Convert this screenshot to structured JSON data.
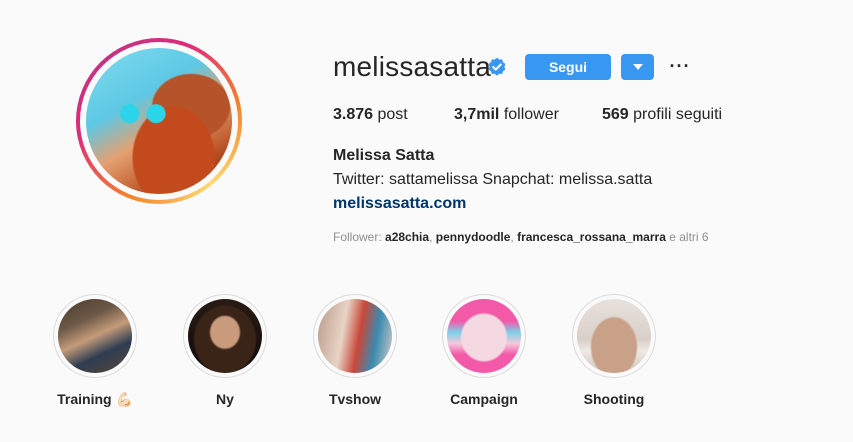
{
  "profile": {
    "username": "melissasatta",
    "follow_label": "Segui",
    "more_label": "···",
    "stats": {
      "posts_value": "3.876",
      "posts_label": "post",
      "followers_value": "3,7mil",
      "followers_label": "follower",
      "following_value": "569",
      "following_label": "profili seguiti"
    },
    "full_name": "Melissa Satta",
    "bio": "Twitter: sattamelissa Snapchat: melissa.satta",
    "website": "melissasatta.com",
    "followed_by": {
      "prefix": "Follower:",
      "names": [
        "a28chia",
        "pennydoodle",
        "francesca_rossana_marra"
      ],
      "suffix": "e altri 6"
    }
  },
  "highlights": [
    {
      "label": "Training 💪🏻"
    },
    {
      "label": "Ny"
    },
    {
      "label": "Tvshow"
    },
    {
      "label": "Campaign"
    },
    {
      "label": "Shooting"
    }
  ],
  "colors": {
    "primary_button": "#3897f0",
    "link": "#003569",
    "verified": "#3897f0"
  }
}
